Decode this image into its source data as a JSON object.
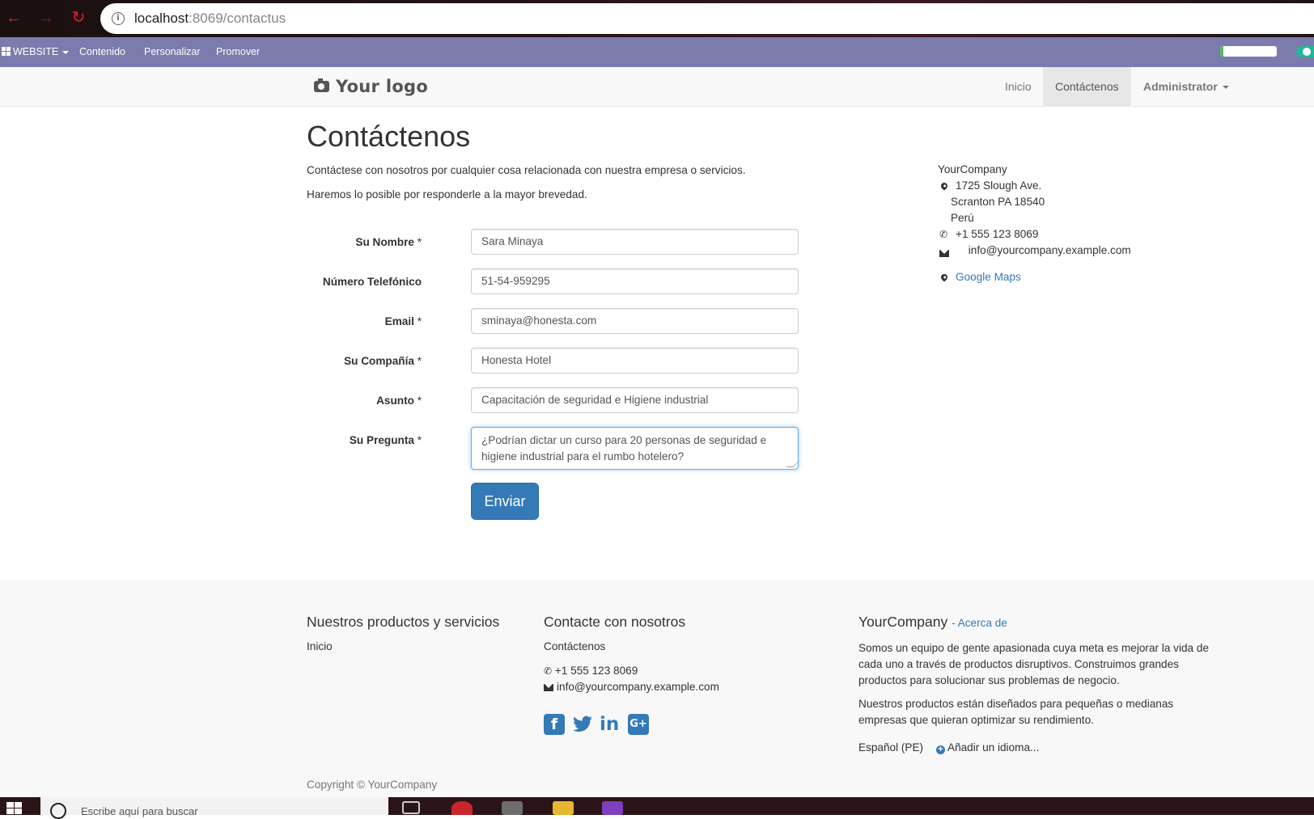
{
  "browser": {
    "url_host": "localhost",
    "url_rest": ":8069/contactus",
    "back_icon": "arrow-left-icon",
    "forward_icon": "arrow-right-icon",
    "reload_icon": "reload-icon"
  },
  "adminbar": {
    "website_label": "WEBSITE",
    "items": [
      "Contenido",
      "Personalizar",
      "Promover"
    ],
    "progress": 0.05,
    "accent": "#7c7bad"
  },
  "navbar": {
    "logo_text": "Your logo",
    "links": [
      "Inicio",
      "Contáctenos",
      "Administrator"
    ],
    "active": "Contáctenos"
  },
  "page": {
    "title": "Contáctenos",
    "intro1": "Contáctese con nosotros por cualquier cosa relacionada con nuestra empresa o servicios.",
    "intro2": "Haremos lo posible por responderle a la mayor brevedad."
  },
  "form": {
    "fields": [
      {
        "label": "Su Nombre",
        "required": "*",
        "value": "Sara Minaya"
      },
      {
        "label": "Número Telefónico",
        "required": "",
        "value": "51-54-959295"
      },
      {
        "label": "Email",
        "required": "*",
        "value": "sminaya@honesta.com"
      },
      {
        "label": "Su Compañía",
        "required": "*",
        "value": "Honesta Hotel"
      },
      {
        "label": "Asunto",
        "required": "*",
        "value": "Capacitación de seguridad e Higiene industrial"
      },
      {
        "label": "Su Pregunta",
        "required": "*",
        "value_line1": "¿Podrían dictar un curso para 20 personas de seguridad e",
        "value_line2": "higiene industrial para el rumbo hotelero?"
      }
    ],
    "submit_label": "Enviar",
    "button_color": "#337ab7"
  },
  "address": {
    "company": "YourCompany",
    "street": "1725 Slough Ave.",
    "city": "Scranton PA 18540",
    "country": "Perú",
    "phone": "+1 555 123 8069",
    "email": "info@yourcompany.example.com",
    "maps_label": "Google Maps"
  },
  "footer": {
    "col1_title": "Nuestros productos y servicios",
    "col1_link": "Inicio",
    "col2_title": "Contacte con nosotros",
    "col2_link": "Contáctenos",
    "col2_phone": "+1 555 123 8069",
    "col2_email": "info@yourcompany.example.com",
    "social_icons": [
      "facebook-icon",
      "twitter-icon",
      "linkedin-icon",
      "google-plus-icon"
    ],
    "col3_title": "YourCompany",
    "col3_about": "- Acerca de",
    "col3_p1_l1": "Somos un equipo de gente apasionada cuya meta es mejorar la vida de",
    "col3_p1_l2": "cada uno a través de productos disruptivos. Construimos grandes",
    "col3_p1_l3": "productos para solucionar sus problemas de negocio.",
    "col3_p2_l1": "Nuestros productos están diseñados para pequeñas o medianas",
    "col3_p2_l2": "empresas que quieran optimizar su rendimiento.",
    "lang": "Español (PE)",
    "add_lang": "Añadir un idioma...",
    "copyright": "Copyright © YourCompany"
  },
  "taskbar": {
    "search_placeholder": "Escribe aquí para buscar"
  }
}
